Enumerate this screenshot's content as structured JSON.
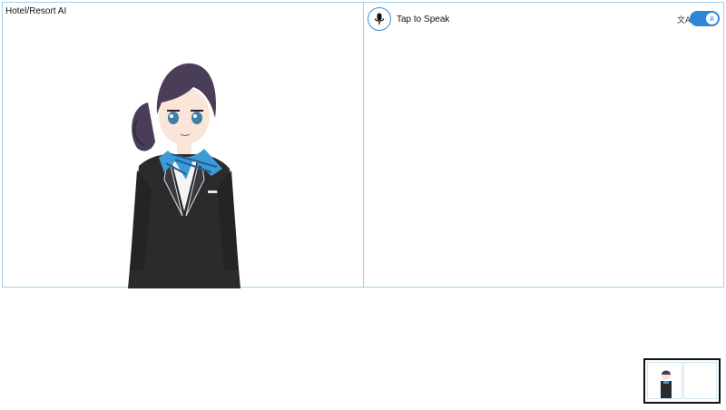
{
  "app": {
    "title": "Hotel/Resort AI"
  },
  "avatar": {
    "description_icon": "anime-hotel-receptionist-avatar"
  },
  "speech": {
    "button_label": "Tap to Speak",
    "mic_icon": "microphone-icon"
  },
  "translation": {
    "icon": "translate-icon",
    "icon_glyph": "文A",
    "toggle_on": true,
    "toggle_glyph": "あ"
  },
  "colors": {
    "panel_border": "#9fd0e6",
    "accent": "#2f86d6",
    "hair": "#4a3d57",
    "suit": "#2b2b2e",
    "scarf": "#3a9bd8"
  }
}
